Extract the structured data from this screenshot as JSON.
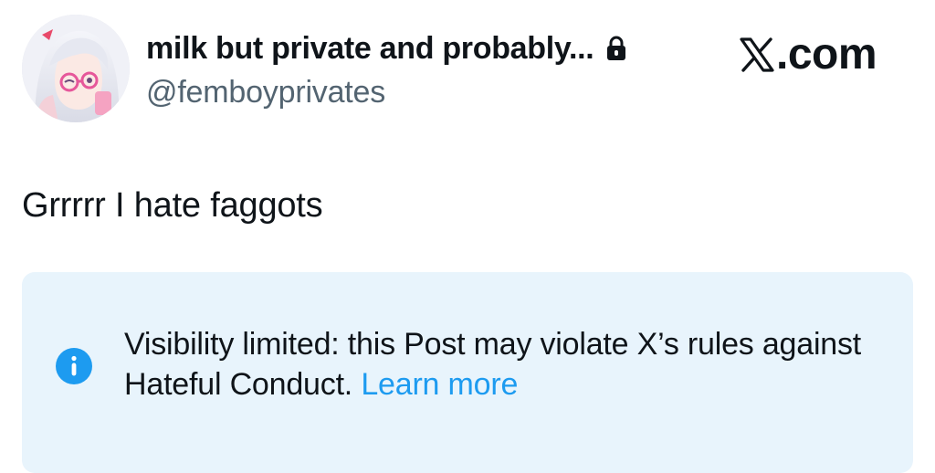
{
  "post": {
    "display_name": "milk but private and probably...",
    "handle": "@femboyprivates",
    "protected_icon": "lock-icon",
    "avatar_icon": "anime-avatar",
    "brand": {
      "icon": "x-logo-icon",
      "text": ".com"
    },
    "text": "Grrrrr I hate faggots"
  },
  "notice": {
    "icon": "info-icon",
    "message": "Visibility limited: this Post may violate X’s rules against Hateful Conduct.",
    "link_label": "Learn more",
    "colors": {
      "background": "#e8f4fc",
      "accent": "#1d9bf0"
    }
  }
}
